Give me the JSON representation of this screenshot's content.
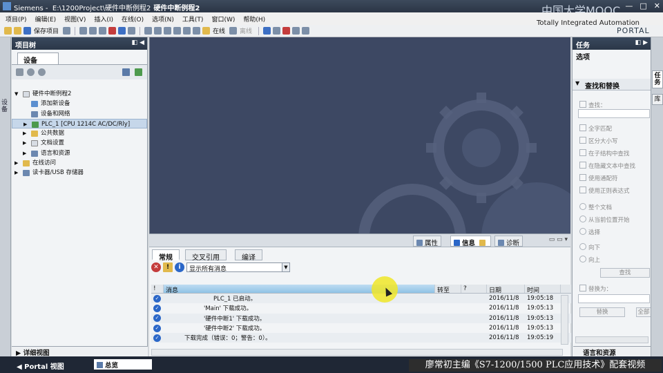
{
  "titlebar": {
    "app": "Siemens",
    "path": "E:\\1200Project\\硬件中断例程2",
    "project": "硬件中断例程2",
    "watermark_top": "中国大学MOOC",
    "watermark_mid": "Totally Integrated Automation",
    "watermark_portal": "PORTAL",
    "window_buttons": [
      "—",
      "□",
      "✕"
    ]
  },
  "menu": [
    "项目(P)",
    "编辑(E)",
    "视图(V)",
    "插入(I)",
    "在线(O)",
    "选项(N)",
    "工具(T)",
    "窗口(W)",
    "帮助(H)"
  ],
  "toolbar": {
    "save_project": "保存项目",
    "go_online": "在线",
    "go_offline": "离线"
  },
  "project_tree": {
    "title": "项目树",
    "devices_tab": "设备",
    "items": [
      {
        "label": "硬件中断例程2",
        "depth": 0,
        "expanded": true
      },
      {
        "label": "添加新设备",
        "depth": 1
      },
      {
        "label": "设备和网络",
        "depth": 1
      },
      {
        "label": "PLC_1 [CPU 1214C AC/DC/Rly]",
        "depth": 1,
        "selected": true
      },
      {
        "label": "公共数据",
        "depth": 1
      },
      {
        "label": "文档设置",
        "depth": 1
      },
      {
        "label": "语言和资源",
        "depth": 1
      },
      {
        "label": "在线访问",
        "depth": 0
      },
      {
        "label": "读卡器/USB 存储器",
        "depth": 0
      }
    ],
    "detail_view": "详细视图",
    "left_strip_label": "设备"
  },
  "inspector": {
    "right_tabs": {
      "properties": "属性",
      "info": "信息",
      "diagnostics": "诊断"
    },
    "subtabs": [
      "常规",
      "交叉引用",
      "编译"
    ],
    "filter_value": "显示所有消息",
    "columns": {
      "icon": "!",
      "message": "消息",
      "goto": "转至",
      "q": "?",
      "date": "日期",
      "time": "时间"
    },
    "messages": [
      {
        "text": "PLC_1 已启动。",
        "indent": 3,
        "date": "2016/11/8",
        "time": "19:05:18"
      },
      {
        "text": "'Main' 下载成功。",
        "indent": 2,
        "date": "2016/11/8",
        "time": "19:05:13"
      },
      {
        "text": "'硬件中断1' 下载成功。",
        "indent": 2,
        "date": "2016/11/8",
        "time": "19:05:13"
      },
      {
        "text": "'硬件中断2' 下载成功。",
        "indent": 2,
        "date": "2016/11/8",
        "time": "19:05:13"
      },
      {
        "text": "下载完成（错误：0；警告：0）。",
        "indent": 1,
        "date": "2016/11/8",
        "time": "19:05:19"
      }
    ]
  },
  "task_panel": {
    "title": "任务",
    "options": "选项",
    "find_replace": "查找和替换",
    "find_label": "查找：",
    "checkboxes": [
      "全字匹配",
      "区分大小写",
      "在子结构中查找",
      "在隐藏文本中查找",
      "使用通配符",
      "使用正则表达式"
    ],
    "scope_radios": [
      "整个文档",
      "从当前位置开始",
      "选择"
    ],
    "direction_radios": [
      "向下",
      "向上"
    ],
    "find_button": "查找",
    "replace_label": "替换为：",
    "replace_button": "替换",
    "replace_all_button": "全部",
    "lang_resources": "语言和资源",
    "vertical_tabs": [
      "任务",
      "库"
    ]
  },
  "statusbar": {
    "portal_view": "Portal 视图",
    "overview": "总览",
    "caption": "廖常初主编《S7-1200/1500 PLC应用技术》配套视频"
  }
}
